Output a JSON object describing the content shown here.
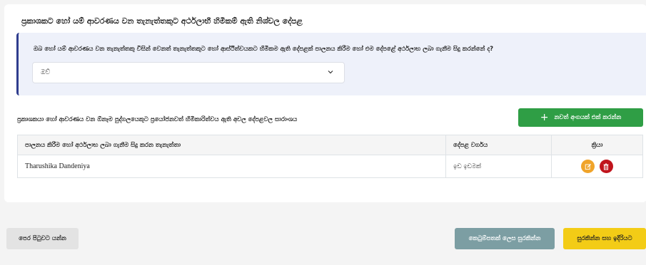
{
  "section": {
    "title": "ප්‍රකාශකට හෝ යම් ආවරණය වන තැනැත්තකුට අර්ථලාභී හිමිකම් ඇති නිශ්චල දේපළ"
  },
  "question": {
    "text": "ඔබ හෝ යම් ආවරණය වන තැනැත්තකු විසින් වෙනත් තැනැත්තකුට හෝ ආස්ථිත්වයකට හිමිකම ඇති දේපළක් පාලනය කිරීම හෝ එම දේපළේ අර්ථලාභ ලබා ගැනීම සිදු කරන්නේ ද?",
    "selected_value": "ඔව්",
    "chevron_icon": "chevron-down-icon"
  },
  "summary": {
    "title": "ප්‍රකාශකයා හෝ ආවරණය වන ඕනෑම පුද්ගලයෙකුට ප්‍රයෝජනවත් හිමිකාරිත්වය ඇති අචල දේපළවල සාරාංශය",
    "add_button_label": "නවත් අංගයක් එක් කරන්න",
    "add_button_icon": "plus-icon"
  },
  "table": {
    "headers": [
      "පාලනය කිරීම හෝ අර්ථලාභ ලබා ගැනීම සිදු කරන තැනැත්තා",
      "දේපළ වර්ගය",
      "ක්‍රියා"
    ],
    "rows": [
      {
        "person": "Tharushika Dandeniya",
        "property_type": "ඉඩ ඉඩමක්",
        "actions": [
          "edit-icon",
          "delete-icon"
        ]
      }
    ]
  },
  "footer": {
    "back_label": "පෙර පිටුවට යන්න",
    "draft_label": "කෙටුම්පතක් ලෙස සුරකින්න",
    "next_label": "සුරකින්න සහ ඉදිරියට"
  },
  "colors": {
    "accent": "#2f3d8e",
    "add_button": "#2f9e45",
    "edit": "#f0a42a",
    "delete": "#c0141c",
    "draft_button": "#7c9ea3",
    "next_button": "#f3cc16"
  }
}
